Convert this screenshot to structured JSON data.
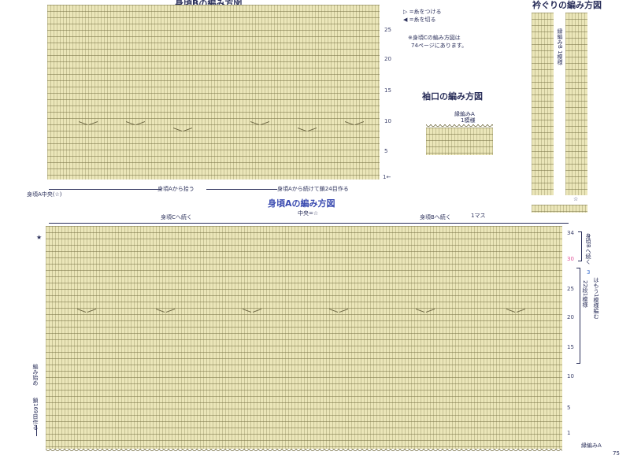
{
  "page_number": "75",
  "body_b": {
    "title": "身頃Bの編み方図",
    "row_numbers": [
      "25",
      "20",
      "15",
      "10",
      "5",
      "1"
    ],
    "row_start_arrow": "1←",
    "center_label": "身頃A中央(☆)",
    "pickup_label": "身頃Aから拾う",
    "continue_label": "身頃Aから続けて鎖24目作る"
  },
  "legend": {
    "join": "▷ =糸をつける",
    "cut": "◀ =糸を切る",
    "note_line1": "※身頃Cの編み方図は",
    "note_line2": "74ページにあります。"
  },
  "sleeve": {
    "title": "袖口の編み方図",
    "edge_label": "縁編みA",
    "repeat_label": "1模様"
  },
  "edging": {
    "title": "衿ぐりの編み方図",
    "vertical_label": "縁編みB 1模様",
    "star": "☆"
  },
  "body_a": {
    "title": "身頃Aの編み方図",
    "left_continue": "身頃Cへ続く",
    "center": "中央=☆",
    "right_continue": "身頃Bへ続く",
    "one_stitch": "1マス",
    "star": "★",
    "row_numbers": [
      "34",
      "30",
      "25",
      "20",
      "15",
      "10",
      "5",
      "1"
    ],
    "right_top_label": "身頃Bへ続く",
    "repeat_note_num": "3",
    "repeat_note": "はもう1模様編む",
    "rows_note": "22段1模様",
    "start_label": "編み始め",
    "chain_label": "鎖169目作る",
    "edge_label": "縁編みA"
  },
  "colors": {
    "chart_fill": "#ebe6b9",
    "grid_line": "#787346",
    "label_ink": "#2a2f5a",
    "title_blue": "#3a4bb0",
    "row_pink": "#e0559a"
  }
}
